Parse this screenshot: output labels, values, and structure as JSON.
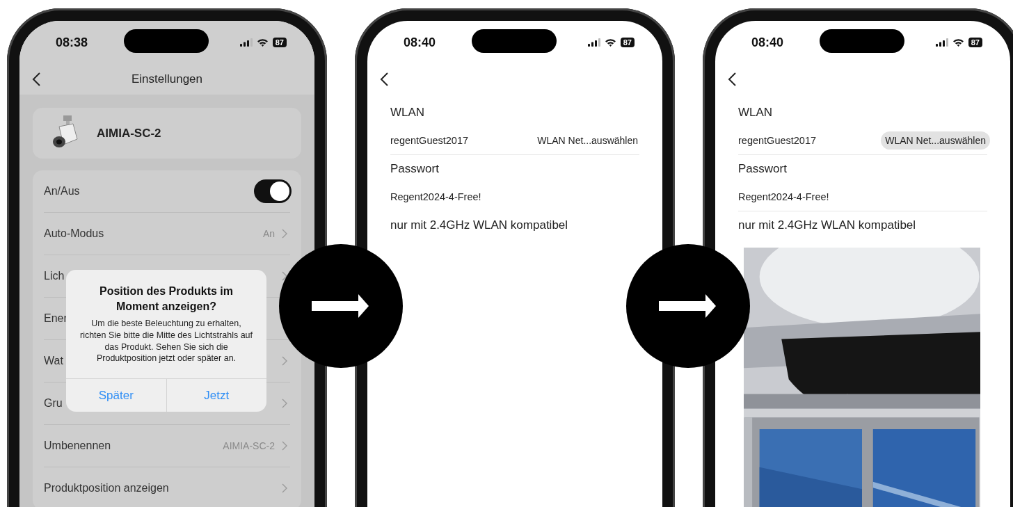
{
  "screens": [
    {
      "kind": "settings",
      "dimmed": true,
      "status_bar": {
        "time": "08:38",
        "battery": "87"
      },
      "title": "Einstellungen",
      "device": {
        "name": "AIMIA-SC-2"
      },
      "rows": [
        {
          "kind": "toggle",
          "label": "An/Aus",
          "on": true
        },
        {
          "kind": "link",
          "label": "Auto-Modus",
          "value": "An",
          "chevron": true
        },
        {
          "kind": "link",
          "label": "Lich",
          "chevron": true
        },
        {
          "kind": "link",
          "label": "Ener"
        },
        {
          "kind": "link",
          "label": "Wat",
          "chevron": true
        },
        {
          "kind": "link",
          "label": "Gru",
          "chevron": true
        },
        {
          "kind": "link",
          "label": "Umbenennen",
          "value": "AIMIA-SC-2",
          "chevron": true
        },
        {
          "kind": "link",
          "label": "Produktposition anzeigen",
          "chevron": true
        }
      ],
      "dialog": {
        "title": "Position des Produkts im Moment anzeigen?",
        "message": "Um die beste Beleuchtung zu erhalten, richten Sie bitte die Mitte des Lichtstrahls auf das Produkt. Sehen Sie sich die Produktposition jetzt oder später an.",
        "buttons": [
          "Später",
          "Jetzt"
        ]
      }
    },
    {
      "kind": "wifi",
      "dimmed": false,
      "status_bar": {
        "time": "08:40",
        "battery": "87"
      },
      "section": "WLAN",
      "network": "regentGuest2017",
      "picker": {
        "label": "WLAN Net...auswählen",
        "pressed": false
      },
      "password_label": "Passwort",
      "password": "Regent2024-4-Free!",
      "password_underlined": false,
      "note": "nur mit 2.4GHz WLAN kompatibel"
    },
    {
      "kind": "wifi",
      "dimmed": false,
      "status_bar": {
        "time": "08:40",
        "battery": "87"
      },
      "section": "WLAN",
      "network": "regentGuest2017",
      "picker": {
        "label": "WLAN Net...auswählen",
        "pressed": true
      },
      "password_label": "Passwort",
      "password": "Regent2024-4-Free!",
      "password_underlined": true,
      "note": "nur mit 2.4GHz WLAN kompatibel"
    }
  ]
}
